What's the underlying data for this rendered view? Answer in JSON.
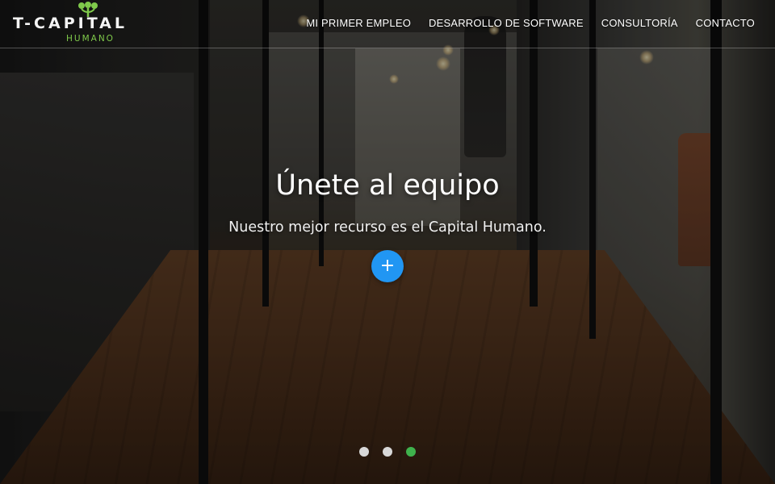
{
  "brand": {
    "logo_main": "T-CAPITAL",
    "logo_sub": "HUMANO",
    "accent_color": "#7fc94b"
  },
  "nav": {
    "items": [
      {
        "label": "MI PRIMER EMPLEO"
      },
      {
        "label": "DESARROLLO DE SOFTWARE"
      },
      {
        "label": "CONSULTORÍA"
      },
      {
        "label": "CONTACTO"
      }
    ]
  },
  "hero": {
    "title": "Únete al equipo",
    "subtitle": "Nuestro mejor recurso es el Capital Humano.",
    "cta_symbol": "+",
    "cta_color": "#2196f3"
  },
  "carousel": {
    "slide_count": 3,
    "active_index": 2,
    "active_color": "#3fb24d",
    "inactive_color": "#d8d8d8"
  },
  "icons": {
    "logo_leaf": "leaf-icon",
    "cta": "plus-icon"
  }
}
